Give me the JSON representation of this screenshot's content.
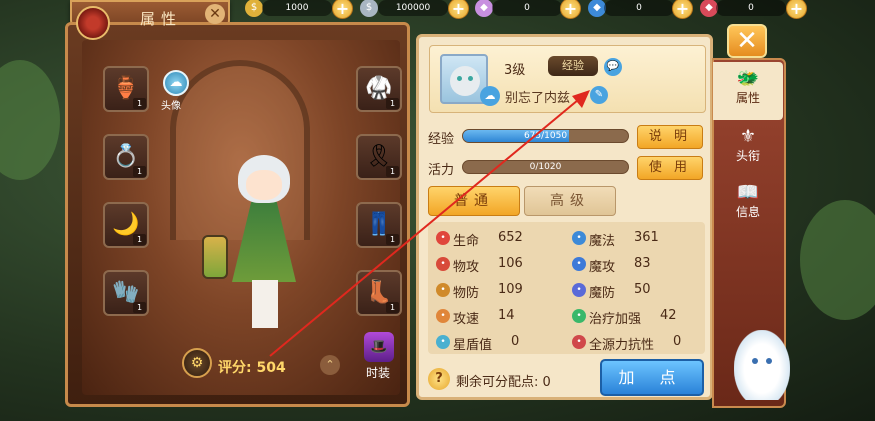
{
  "header": {
    "title": "属性"
  },
  "currencies": [
    {
      "icon": "gold-coin-icon",
      "value": "1000"
    },
    {
      "icon": "silver-coin-icon",
      "value": "100000"
    },
    {
      "icon": "crystal-icon",
      "value": "0"
    },
    {
      "icon": "blue-gem-icon",
      "value": "0"
    },
    {
      "icon": "red-gem-icon",
      "value": "0"
    }
  ],
  "left": {
    "avatar_label": "头像",
    "equip_counts": [
      "1",
      "1",
      "1",
      "1",
      "1",
      "1",
      "1",
      "1"
    ],
    "rating_label": "评分:",
    "rating_value": "504",
    "fashion_label": "时装"
  },
  "profile": {
    "level": "3级",
    "exp_tag": "经验",
    "signature": "别忘了内兹"
  },
  "bars": {
    "exp_label": "经验",
    "exp_text": "675/1050",
    "exp_fraction": 0.643,
    "vitality_label": "活力",
    "vitality_text": "0/1020",
    "vitality_fraction": 0.0,
    "explain_button": "说 明",
    "use_button": "使 用"
  },
  "tabs": {
    "normal": "普通",
    "advanced": "高级"
  },
  "stats": [
    {
      "name": "生命",
      "value": "652",
      "icon": "heart-icon",
      "color": "#e0463c"
    },
    {
      "name": "魔法",
      "value": "361",
      "icon": "magic-icon",
      "color": "#3d8ad8"
    },
    {
      "name": "物攻",
      "value": "106",
      "icon": "sword-icon",
      "color": "#d84a3a"
    },
    {
      "name": "魔攻",
      "value": "83",
      "icon": "magic-attack-icon",
      "color": "#3d7ad8"
    },
    {
      "name": "物防",
      "value": "109",
      "icon": "shield-icon",
      "color": "#d08a2a"
    },
    {
      "name": "魔防",
      "value": "50",
      "icon": "magic-shield-icon",
      "color": "#5a6ad8"
    },
    {
      "name": "攻速",
      "value": "14",
      "icon": "speed-icon",
      "color": "#e0863a"
    },
    {
      "name": "治疗加强",
      "value": "42",
      "icon": "heal-icon",
      "color": "#3ab86a"
    },
    {
      "name": "星盾值",
      "value": "0",
      "icon": "star-shield-icon",
      "color": "#4ab0d0"
    },
    {
      "name": "全源力抗性",
      "value": "0",
      "icon": "resist-icon",
      "color": "#d0484a"
    }
  ],
  "bottom": {
    "remaining_label": "剩余可分配点:",
    "remaining_value": "0",
    "add_point_button": "加 点"
  },
  "side_tabs": [
    {
      "label": "属性",
      "icon": "attributes-icon"
    },
    {
      "label": "头衔",
      "icon": "title-icon"
    },
    {
      "label": "信息",
      "icon": "info-icon"
    }
  ]
}
